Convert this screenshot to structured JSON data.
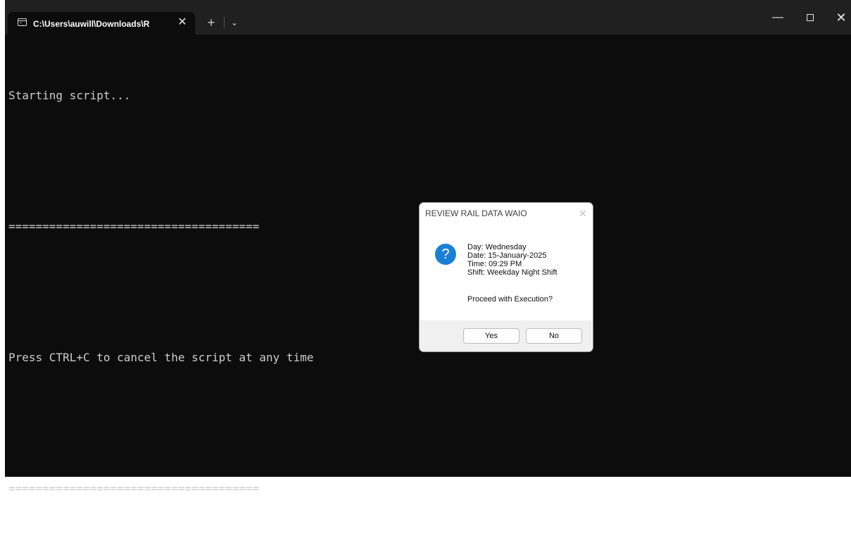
{
  "window": {
    "tab_title": "C:\\Users\\auwill\\Downloads\\R",
    "tab_close": "✕",
    "new_tab": "+",
    "tab_dropdown": "⌄",
    "minimize": "—",
    "close": "✕"
  },
  "console": {
    "lines": [
      "Starting script...",
      "",
      "=====================================",
      "",
      "Press CTRL+C to cancel the script at any time",
      "",
      "====================================="
    ]
  },
  "dialog": {
    "title": "REVIEW RAIL DATA WAIO",
    "close": "✕",
    "icon": "?",
    "message_lines": [
      "Day: Wednesday",
      "Date: 15-January-2025",
      "Time: 09:29 PM",
      "Shift: Weekday Night Shift"
    ],
    "prompt": "Proceed with Execution?",
    "yes_label": "Yes",
    "no_label": "No"
  },
  "colors": {
    "terminal_bg": "#0c0c0c",
    "titlebar_bg": "#202020",
    "terminal_text": "#cccccc",
    "question_icon": "#1b7fd6",
    "dialog_footer": "#f0f0f0"
  },
  "icons": {
    "tab_icon": "terminal-icon",
    "dialog_icon": "question-icon"
  }
}
